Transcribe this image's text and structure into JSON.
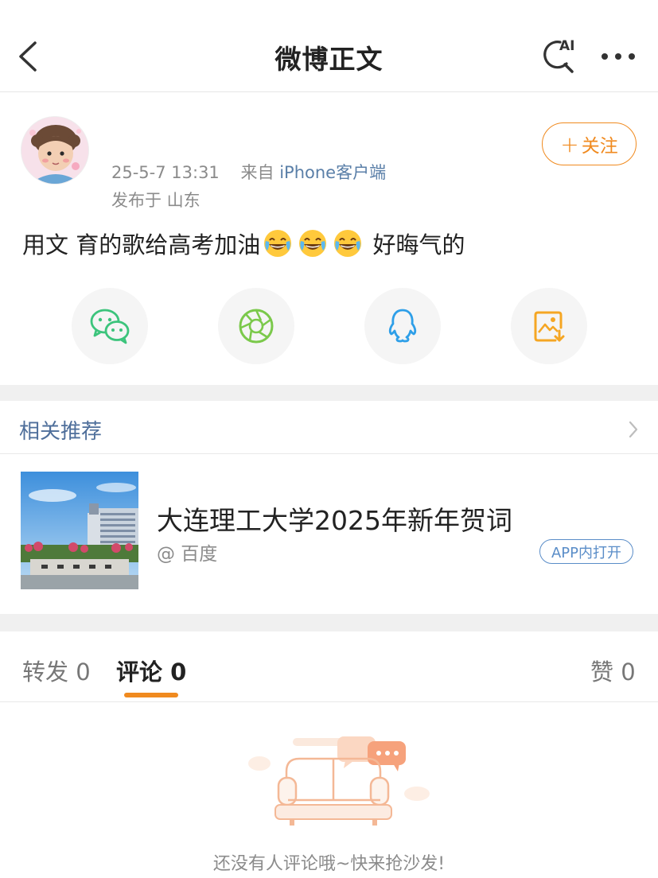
{
  "header": {
    "title": "微博正文",
    "ai_label": "AI"
  },
  "post": {
    "timestamp": "25-5-7 13:31",
    "source_prefix": "来自",
    "source_name": "iPhone客户端",
    "location": "发布于 山东",
    "follow_label": "关注",
    "text_before_emoji": "用文 育的歌给高考加油",
    "emoji_name": "laugh-crying-emoji",
    "text_after_emoji": "好晦气的"
  },
  "share": {
    "items": [
      {
        "icon": "wechat-icon",
        "color": "#3cc47c"
      },
      {
        "icon": "moments-icon",
        "color": "#7bc94b"
      },
      {
        "icon": "qq-icon",
        "color": "#2e9fe8"
      },
      {
        "icon": "save-image-icon",
        "color": "#f5a623"
      }
    ]
  },
  "related": {
    "title": "相关推荐",
    "item": {
      "headline": "大连理工大学2025年新年贺词",
      "source": "@ 百度",
      "open_app_label": "APP内打开"
    }
  },
  "tabs": {
    "repost": "转发 0",
    "comment": "评论 0",
    "like": "赞 0"
  },
  "empty": {
    "text": "还没有人评论哦~快来抢沙发!"
  },
  "colors": {
    "accent": "#f08a1f",
    "link": "#5a7fa8",
    "section_bg": "#f0f0f0"
  }
}
